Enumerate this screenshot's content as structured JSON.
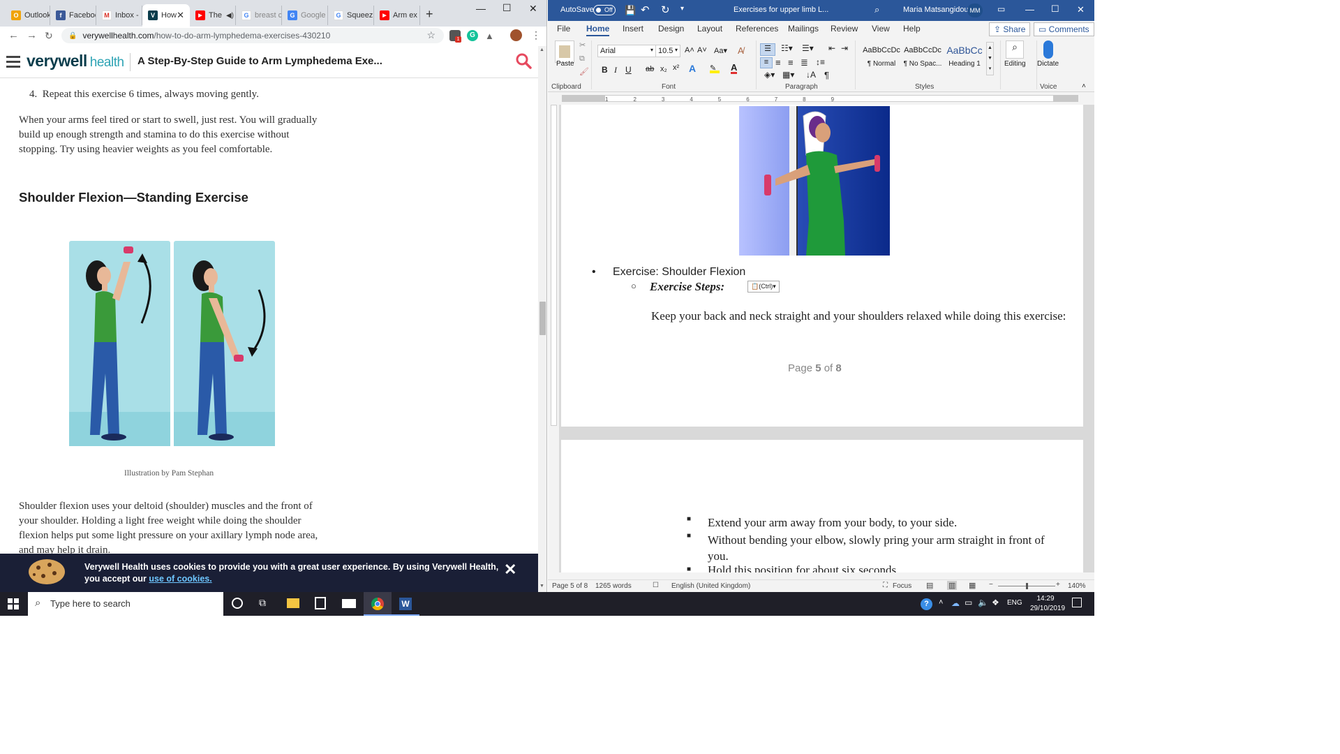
{
  "chrome": {
    "tabs": [
      {
        "label": "Outlook",
        "color": "#f0a30a",
        "glyph": "O"
      },
      {
        "label": "Facebook",
        "color": "#3b5998",
        "glyph": "f"
      },
      {
        "label": "Inbox -",
        "color": "#ffffff",
        "glyph": "M"
      },
      {
        "label": "How",
        "color": "#0b3d4c",
        "glyph": "V"
      },
      {
        "label": "The",
        "color": "#ff0000",
        "glyph": "▶"
      },
      {
        "label": "breast c",
        "color": "#ffffff",
        "glyph": "G"
      },
      {
        "label": "Google",
        "color": "#4285f4",
        "glyph": "G"
      },
      {
        "label": "Squeez",
        "color": "#ffffff",
        "glyph": "G"
      },
      {
        "label": "Arm ex",
        "color": "#ff0000",
        "glyph": "▶"
      }
    ],
    "url_host": "verywellhealth.com",
    "url_path": "/how-to-do-arm-lymphedema-exercises-430210"
  },
  "verywell": {
    "logo_main": "verywell",
    "logo_sub": "health",
    "header_title": "A Step-By-Step Guide to Arm Lymphedema Exe...",
    "step4": "Repeat this exercise 6 times, always moving gently.",
    "para1": "When your arms feel tired or start to swell, just rest. You will gradually build up enough strength and stamina to do this exercise without stopping. Try using heavier weights as you feel comfortable.",
    "heading": "Shoulder Flexion—Standing Exercise",
    "caption": "Illustration by Pam Stephan",
    "para2": "Shoulder flexion uses your deltoid (shoulder) muscles and the front of your shoulder. Holding a light free weight while doing the shoulder flexion helps put some light pressure on your axillary lymph node area, and may help it drain.",
    "cookie_text": "Verywell Health uses cookies to provide you with a great user experience. By using Verywell Health, you accept our ",
    "cookie_link": "use of cookies."
  },
  "word": {
    "autosave_label": "AutoSave",
    "autosave_state": "Off",
    "doc_title": "Exercises for upper limb L...",
    "user_name": "Maria Matsangidou",
    "user_initials": "MM",
    "tabs": [
      "File",
      "Home",
      "Insert",
      "Design",
      "Layout",
      "References",
      "Mailings",
      "Review",
      "View",
      "Help"
    ],
    "share": "Share",
    "comments": "Comments",
    "font_name": "Arial",
    "font_size": "10.5",
    "paste_label": "Paste",
    "styles": [
      {
        "preview": "AaBbCcDc",
        "name": "¶ Normal"
      },
      {
        "preview": "AaBbCcDc",
        "name": "¶ No Spac..."
      },
      {
        "preview": "AaBbCc",
        "name": "Heading 1"
      }
    ],
    "editing_label": "Editing",
    "dictate_label": "Dictate",
    "groups": [
      "Clipboard",
      "Font",
      "Paragraph",
      "Styles",
      "Voice"
    ],
    "bullet_exercise": "Exercise: Shoulder Flexion",
    "sub_bullet": "Exercise Steps:",
    "ctrl_tag": "(Ctrl)",
    "instruction": "Keep your back and neck straight and your shoulders relaxed while doing this exercise:",
    "page_indicator_prefix": "Page ",
    "page_indicator_num": "5",
    "page_indicator_mid": " of ",
    "page_indicator_total": "8",
    "steps": [
      "Extend your arm away from your body, to your side.",
      "Without bending your elbow, slowly pring your arm straight in front of you.",
      "Hold this position for about six seconds."
    ],
    "status_page": "Page 5 of 8",
    "status_words": "1265 words",
    "status_lang": "English (United Kingdom)",
    "status_focus": "Focus",
    "zoom": "140%"
  },
  "taskbar": {
    "search_placeholder": "Type here to search",
    "lang": "ENG",
    "time": "14:29",
    "date": "29/10/2019"
  }
}
